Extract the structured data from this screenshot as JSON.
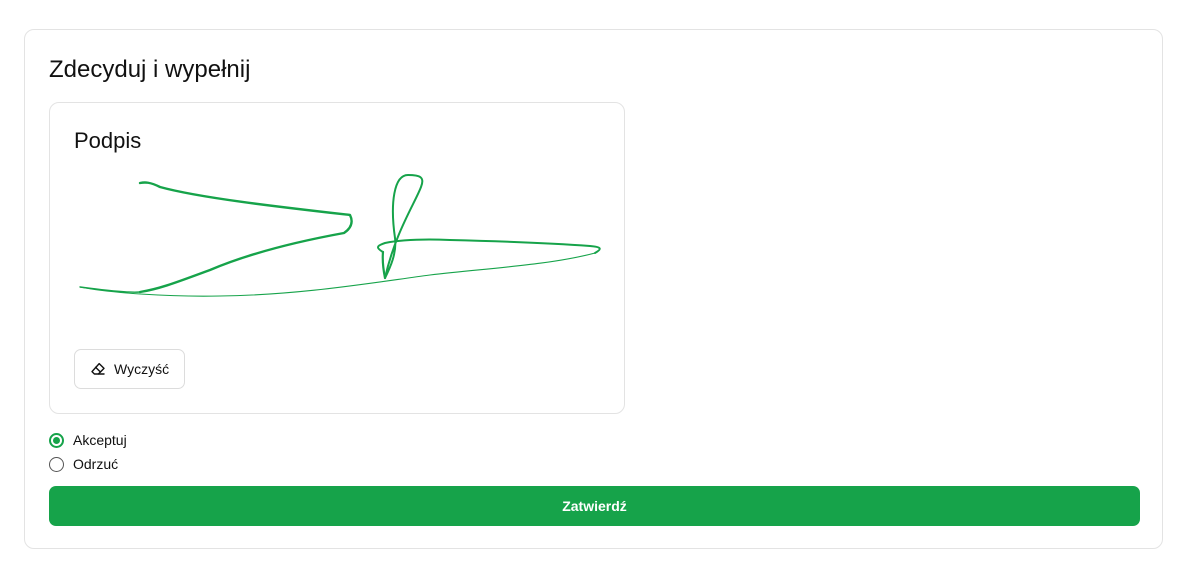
{
  "form": {
    "title": "Zdecyduj i wypełnij"
  },
  "signature": {
    "title": "Podpis",
    "stroke_color": "#16a34a",
    "clear_label": "Wyczyść",
    "clear_icon": "eraser-icon"
  },
  "decision": {
    "options": [
      {
        "label": "Akceptuj",
        "checked": true
      },
      {
        "label": "Odrzuć",
        "checked": false
      }
    ]
  },
  "submit": {
    "label": "Zatwierdź"
  },
  "colors": {
    "accent": "#16a34a",
    "border": "#e3e3e3"
  }
}
